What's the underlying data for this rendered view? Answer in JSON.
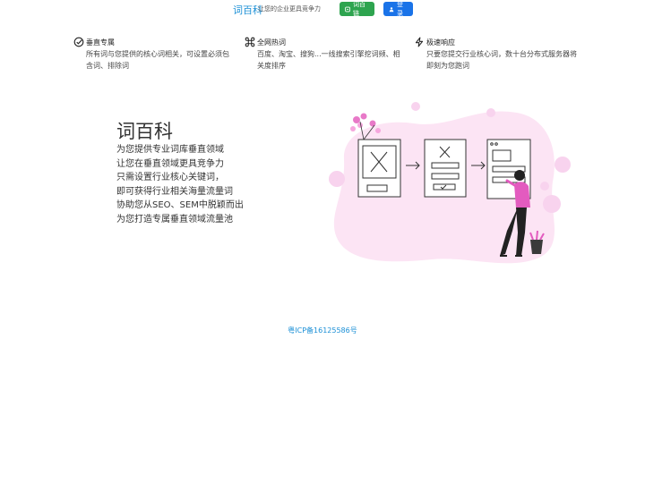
{
  "header": {
    "brand": "词百科",
    "tagline": "让您的企业更具竞争力",
    "button_green_label": "词百链",
    "button_blue_label": "登录"
  },
  "features": [
    {
      "icon": "check-circle-icon",
      "title": "垂直专属",
      "desc": "所有词与您提供的核心词相关，可设置必须包含词、排除词"
    },
    {
      "icon": "command-icon",
      "title": "全网热词",
      "desc": "百度、淘宝、搜狗...一线搜索引擎挖词频、相关度排序"
    },
    {
      "icon": "lightning-icon",
      "title": "极速响应",
      "desc": "只要您提交行业核心词，数十台分布式服务器将即刻为您跑词"
    }
  ],
  "hero": {
    "title": "词百科",
    "lines": [
      "为您提供专业词库垂直领域",
      "让您在垂直领域更具竞争力",
      "只需设置行业核心关键词，",
      "即可获得行业相关海量流量词",
      "协助您从SEO、SEM中脱颖而出",
      "为您打造专属垂直领域流量池"
    ]
  },
  "footer": {
    "icp": "粤ICP备16125586号"
  },
  "colors": {
    "accent": "#1a8fd6",
    "green": "#2ea44f",
    "blue": "#1a73e8",
    "pink": "#f06ec5"
  }
}
